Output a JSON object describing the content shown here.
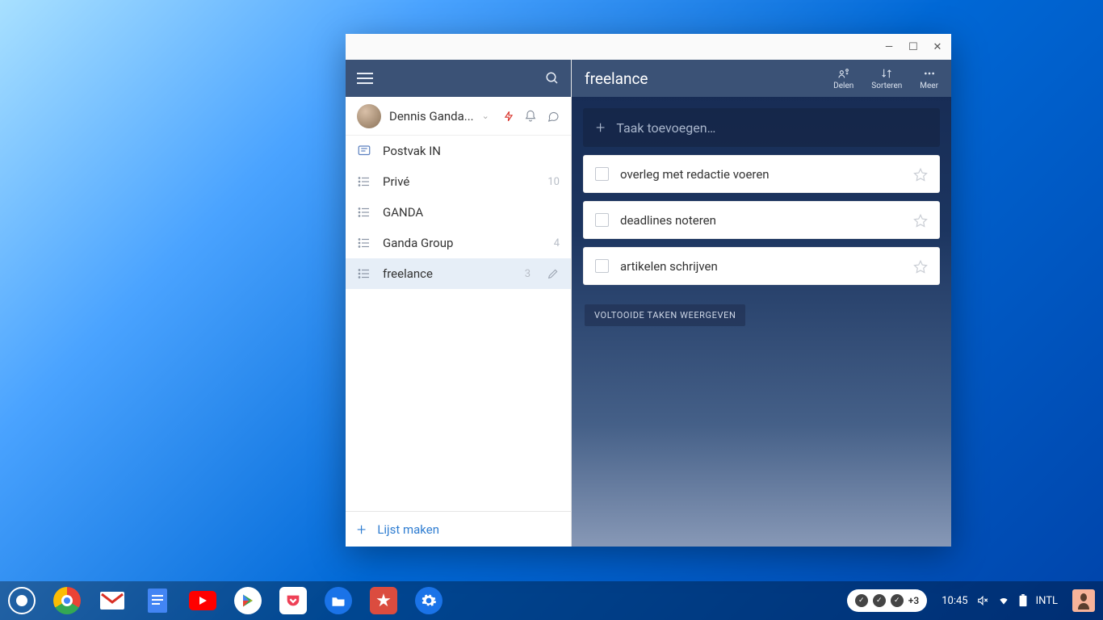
{
  "window": {
    "controls": {
      "minimize": "—",
      "maximize": "☐",
      "close": "✕"
    }
  },
  "sidebar": {
    "profile_name": "Dennis Ganda...",
    "inbox_label": "Postvak IN",
    "lists": [
      {
        "label": "Privé",
        "count": "10"
      },
      {
        "label": "GANDA",
        "count": ""
      },
      {
        "label": "Ganda Group",
        "count": "4"
      },
      {
        "label": "freelance",
        "count": "3"
      }
    ],
    "new_list_label": "Lijst maken"
  },
  "main": {
    "title": "freelance",
    "actions": {
      "share": "Delen",
      "sort": "Sorteren",
      "more": "Meer"
    },
    "add_task_placeholder": "Taak toevoegen…",
    "tasks": [
      {
        "title": "overleg met redactie voeren"
      },
      {
        "title": "deadlines noteren"
      },
      {
        "title": "artikelen schrijven"
      }
    ],
    "show_completed": "VOLTOOIDE TAKEN WEERGEVEN"
  },
  "taskbar": {
    "notif_count": "+3",
    "time": "10:45",
    "keyboard": "INTL"
  }
}
